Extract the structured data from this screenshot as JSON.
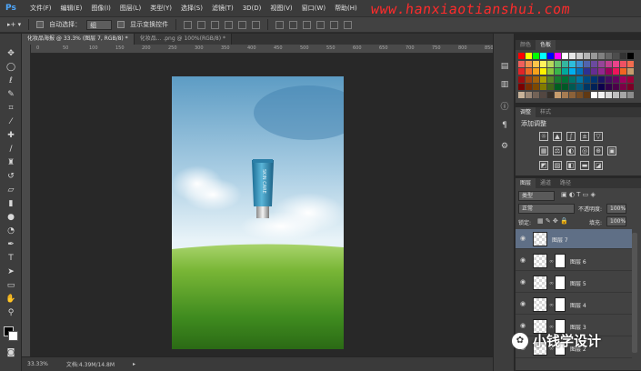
{
  "app": {
    "logo": "Ps"
  },
  "menu": [
    "文件(F)",
    "编辑(E)",
    "图像(I)",
    "图层(L)",
    "类型(Y)",
    "选择(S)",
    "滤镜(T)",
    "3D(D)",
    "视图(V)",
    "窗口(W)",
    "帮助(H)"
  ],
  "watermark_top": "www.hanxiaotianshui.com",
  "options": {
    "auto_select_label": "自动选择：",
    "auto_select_value": "组",
    "show_transform_label": "显示变换控件"
  },
  "tabs": [
    {
      "label": "化妆品海报 @ 33.3% (图层 7, RGB/8) *",
      "active": true
    },
    {
      "label": "化妆品... .png @ 100%(RGB/8) *",
      "active": false
    }
  ],
  "ruler_ticks": [
    "0",
    "50",
    "100",
    "150",
    "200",
    "250",
    "300",
    "350",
    "400",
    "450",
    "500",
    "550",
    "600",
    "650",
    "700",
    "750",
    "800",
    "850"
  ],
  "status": {
    "zoom": "33.33%",
    "doc": "文档:4.39M/14.8M"
  },
  "panels": {
    "color_tabs": [
      "颜色",
      "色板"
    ],
    "adjust_tabs": [
      "调整",
      "样式"
    ],
    "adjust_title": "添加调整",
    "layers_tabs": [
      "图层",
      "通道",
      "路径"
    ],
    "filter_kind": "类型",
    "blend_mode": "正常",
    "opacity_label": "不透明度:",
    "opacity_value": "100%",
    "lock_label": "锁定:",
    "fill_label": "填充:",
    "fill_value": "100%"
  },
  "layers": [
    {
      "name": "图层 7",
      "selected": true,
      "mask": false
    },
    {
      "name": "图层 6",
      "selected": false,
      "mask": true
    },
    {
      "name": "图层 5",
      "selected": false,
      "mask": true
    },
    {
      "name": "图层 4",
      "selected": false,
      "mask": true
    },
    {
      "name": "图层 3",
      "selected": false,
      "mask": true
    },
    {
      "name": "图层 2",
      "selected": false,
      "mask": true
    }
  ],
  "product_text": "SKIN CARE",
  "watermark_badge": "小钱学设计",
  "colors": {
    "selection": "#5f6f86",
    "panel": "#424242",
    "workspace": "#282828"
  }
}
